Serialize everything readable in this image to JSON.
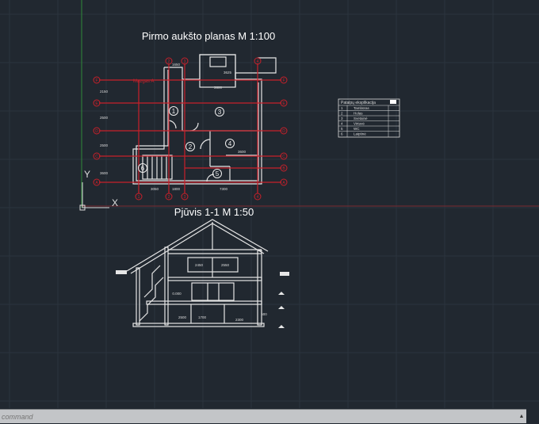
{
  "plan": {
    "title": "Pirmo aukšto planas M 1:100",
    "room_numbers": [
      "1",
      "2",
      "3",
      "4",
      "5",
      "6"
    ],
    "grid_top": [
      "2",
      "3",
      "4"
    ],
    "grid_bottom": [
      "1",
      "2",
      "3",
      "4"
    ],
    "grid_side": [
      "F",
      "E",
      "D",
      "C",
      "B",
      "A"
    ],
    "dims": [
      "1650",
      "3625",
      "3600",
      "3600",
      "3050",
      "1800",
      "7300",
      "2150",
      "2500",
      "2500",
      "3600"
    ],
    "section_mark": "Mazgas A"
  },
  "section": {
    "title": "Pjūvis 1-1 M 1:50",
    "dims": [
      "2450",
      "2550",
      "0.000",
      "2500",
      "1700",
      "2300",
      "600"
    ]
  },
  "table": {
    "title": "Patalpų eksplikacija",
    "rows": [
      {
        "n": "1",
        "name": "Tambūras"
      },
      {
        "n": "2",
        "name": "Holas"
      },
      {
        "n": "3",
        "name": "Svetainė"
      },
      {
        "n": "4",
        "name": "Virtuvė"
      },
      {
        "n": "5",
        "name": "WC"
      },
      {
        "n": "6",
        "name": "Laiptinė"
      }
    ]
  },
  "ucs": {
    "x_label": "X",
    "y_label": "Y"
  },
  "command": {
    "placeholder": "command"
  },
  "colors": {
    "background": "#212830",
    "grid": "#2c343e",
    "axis_red": "#c8202a",
    "axis_green": "#2e8a3a",
    "lines": "#e6e6e6"
  }
}
